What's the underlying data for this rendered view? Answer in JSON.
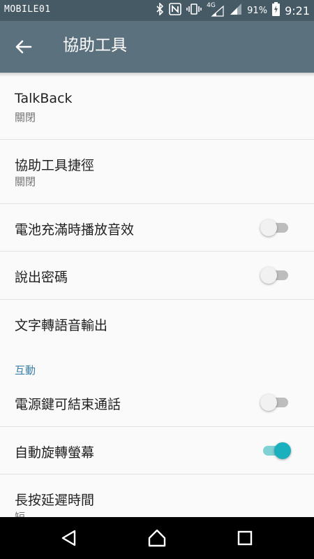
{
  "status_bar": {
    "logo": "MOBILE01",
    "network": "4G",
    "battery": "91%",
    "time": "9:21",
    "icons": [
      "bluetooth-icon",
      "nfc-icon",
      "vibrate-icon",
      "signal-icon",
      "battery-charging-icon"
    ]
  },
  "app_bar": {
    "title": "協助工具",
    "back_icon": "arrow-back-icon"
  },
  "items": {
    "talkback": {
      "title": "TalkBack",
      "summary": "關閉"
    },
    "shortcut": {
      "title": "協助工具捷徑",
      "summary": "關閉"
    },
    "battery_sound": {
      "title": "電池充滿時播放音效",
      "toggle": false
    },
    "speak_passwords": {
      "title": "說出密碼",
      "toggle": false
    },
    "tts_output": {
      "title": "文字轉語音輸出"
    },
    "power_end_call": {
      "title": "電源鍵可結束通話",
      "toggle": false
    },
    "auto_rotate": {
      "title": "自動旋轉螢幕",
      "toggle": true
    },
    "long_press_delay": {
      "title": "長按延遲時間",
      "summary": "短"
    }
  },
  "sections": {
    "interaction": "互動"
  },
  "nav_bar": {
    "buttons": [
      "back-triangle-icon",
      "home-icon",
      "recents-icon"
    ]
  },
  "colors": {
    "status_bar": "#465a66",
    "app_bar": "#5b717d",
    "accent": "#1bb0bd",
    "section_header": "#3a7fa6"
  }
}
